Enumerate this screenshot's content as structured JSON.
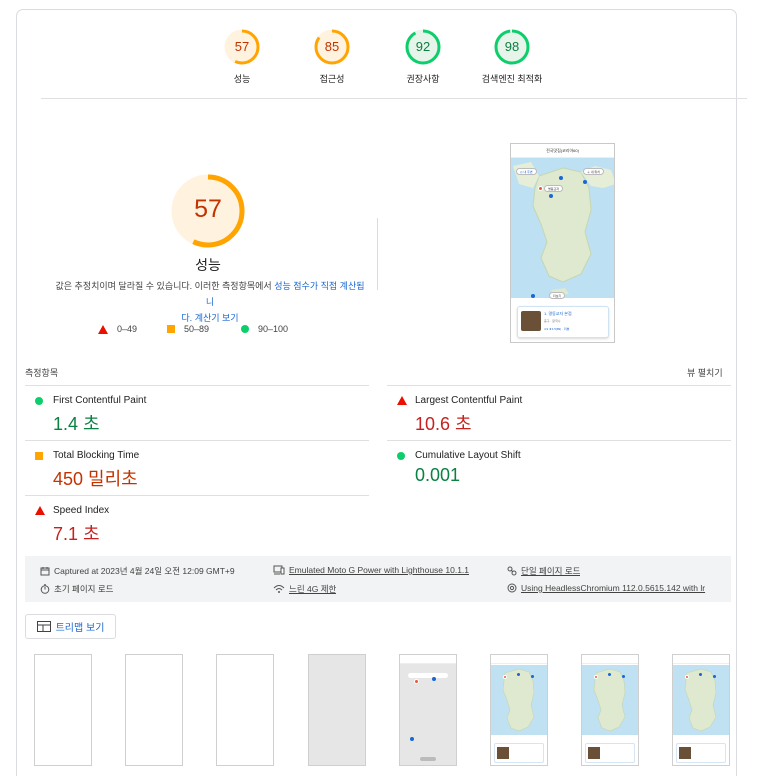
{
  "top_scores": [
    {
      "value": "57",
      "label": "성능",
      "color": "#ffa400",
      "fill": "#fff3e0",
      "text_color": "#c33300",
      "fraction": 0.57
    },
    {
      "value": "85",
      "label": "접근성",
      "color": "#ffa400",
      "fill": "#fff3e0",
      "text_color": "#c33300",
      "fraction": 0.85
    },
    {
      "value": "92",
      "label": "권장사항",
      "color": "#0cce6b",
      "fill": "#e6f4ea",
      "text_color": "#0b8043",
      "fraction": 0.92
    },
    {
      "value": "98",
      "label": "검색엔진 최적화",
      "color": "#0cce6b",
      "fill": "#e6f4ea",
      "text_color": "#0b8043",
      "fraction": 0.98
    }
  ],
  "performance": {
    "score": "57",
    "fraction": 0.57,
    "label": "성능",
    "description_prefix": "값은 추정치이며 달라질 수 있습니다. 이러한 측정항목에서 ",
    "description_link": "성능 점수가 직접 계산됩니",
    "description_link2": "다.",
    "calculator_link": " 계산기 보기"
  },
  "legend": {
    "poor": "0–49",
    "average": "50–89",
    "good": "90–100"
  },
  "screenshot": {
    "title": "전국맛집(코리아60)",
    "card_title": "1. 명동교자 본점",
    "card_sub": "중구 · 칼국수",
    "card_meta": "4.9 ★4.5(89) · 리뷰"
  },
  "metrics_section": {
    "title": "측정항목",
    "expand_label": "뷰 펼치기"
  },
  "metrics": {
    "fcp": {
      "name": "First Contentful Paint",
      "value": "1.4 초",
      "status": "good"
    },
    "lcp": {
      "name": "Largest Contentful Paint",
      "value": "10.6 초",
      "status": "poor"
    },
    "tbt": {
      "name": "Total Blocking Time",
      "value": "450 밀리초",
      "status": "poor"
    },
    "cls": {
      "name": "Cumulative Layout Shift",
      "value": "0.001",
      "status": "good"
    },
    "si": {
      "name": "Speed Index",
      "value": "7.1 초",
      "status": "poor"
    }
  },
  "runtime": {
    "captured": "Captured at 2023년 4월 24일 오전 12:09 GMT+9",
    "device": "Emulated Moto G Power with Lighthouse 10.1.1",
    "page_mode": "단일 페이지 로드",
    "initial_load": "초기 페이지 로드",
    "throttling": "느린 4G 제한",
    "browser": "Using HeadlessChromium 112.0.5615.142 with lr"
  },
  "treemap_button": "트리맵 보기",
  "filmstrip": [
    "blank",
    "blank",
    "blank",
    "gray",
    "partial",
    "full",
    "full",
    "full"
  ]
}
